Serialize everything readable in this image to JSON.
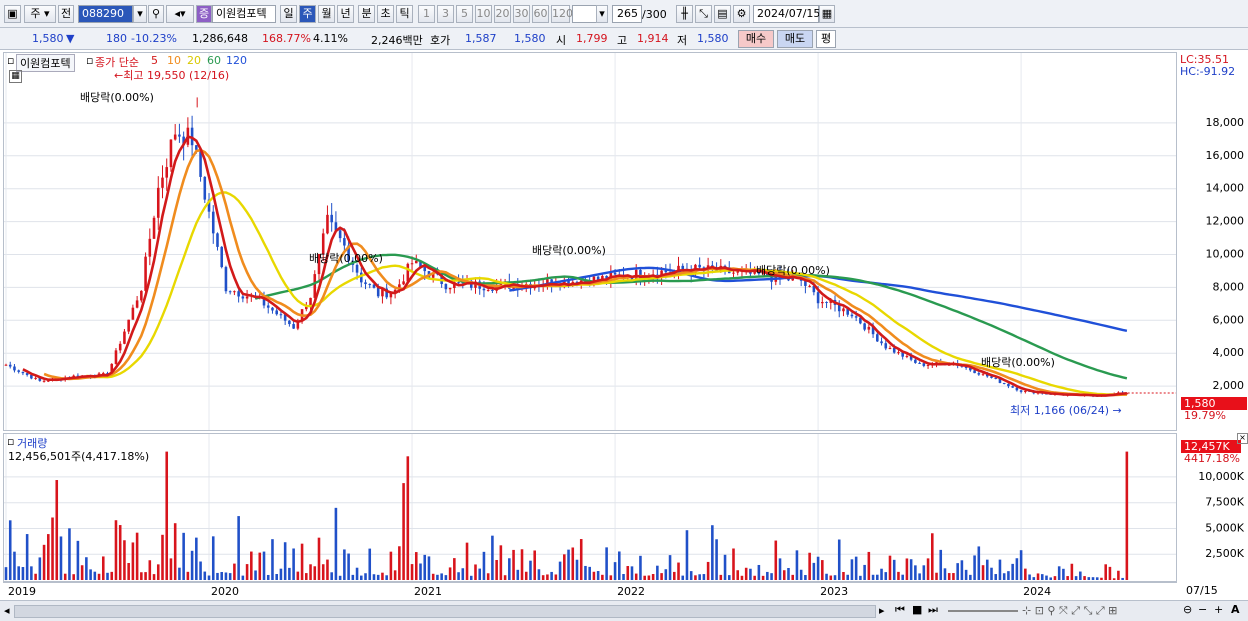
{
  "toolbar": {
    "period_label": "주",
    "prev_label": "전",
    "code": "088290",
    "stock_name_tag": "증",
    "stock_name": "이원컴포텍",
    "tabs": [
      "일",
      "주",
      "월",
      "년",
      "분",
      "초",
      "틱"
    ],
    "active_tab": "주",
    "numbers": [
      "1",
      "3",
      "5",
      "10",
      "20",
      "30",
      "60",
      "120"
    ],
    "count": "265",
    "count_total": "/300",
    "date": "2024/07/15"
  },
  "quote": {
    "price": "1,580",
    "change_arrow": "▼",
    "change": "180",
    "change_pct": "-10.23%",
    "volume": "1,286,648",
    "vol_ratio": "168.77%",
    "turnover": "4.11%",
    "amount": "2,246백만",
    "hoga_label": "호가",
    "hoga_ask": "1,587",
    "hoga_bid": "1,580",
    "open_label": "시",
    "open": "1,799",
    "high_label": "고",
    "high": "1,914",
    "low_label": "저",
    "low": "1,580",
    "buy_label": "매수",
    "sell_label": "매도",
    "eval_label": "평"
  },
  "price_pane": {
    "name": "이원컴포텍",
    "ma_legend": "종가 단순",
    "ma_periods": [
      "5",
      "10",
      "20",
      "60",
      "120"
    ],
    "ma_colors": [
      "#d21a1a",
      "#f08c1e",
      "#e8d800",
      "#2a9a50",
      "#2050d8"
    ],
    "high_note": "←최고 19,550 (12/16)",
    "low_note": "최저 1,166 (06/24) →",
    "lc_label": "LC:35.51",
    "hc_label": "HC:-91.92",
    "dividend_label": "배당락(0.00%)",
    "last_price_tag": "1,580",
    "last_pct_tag": "19.79%"
  },
  "volume_pane": {
    "title": "거래량",
    "last_value": "12,456,501주(4,417.18%)",
    "last_tag": "12,457K",
    "last_pct": "4417.18%"
  },
  "chart_data": [
    {
      "type": "line",
      "title": "이원컴포텍 주봉",
      "x": [
        "2019-01",
        "2019-03",
        "2019-05",
        "2019-07",
        "2019-09",
        "2019-10",
        "2019-11",
        "2019-12",
        "2020-01",
        "2020-02",
        "2020-03",
        "2020-04",
        "2020-06",
        "2020-07",
        "2020-08",
        "2020-09",
        "2020-10",
        "2020-11",
        "2020-12",
        "2021-01",
        "2021-03",
        "2021-06",
        "2021-09",
        "2021-12",
        "2022-03",
        "2022-06",
        "2022-09",
        "2022-12",
        "2023-01",
        "2023-03",
        "2023-05",
        "2023-07",
        "2023-09",
        "2023-11",
        "2024-01",
        "2024-03",
        "2024-05",
        "2024-07"
      ],
      "series": [
        {
          "name": "종가",
          "values": [
            3300,
            2300,
            2600,
            2700,
            8000,
            14000,
            17500,
            17000,
            12500,
            8000,
            7600,
            7200,
            5600,
            7500,
            12000,
            10500,
            8500,
            7600,
            7800,
            9500,
            8200,
            8100,
            8300,
            8500,
            8900,
            9100,
            8800,
            8400,
            7300,
            6400,
            4400,
            3300,
            3400,
            2600,
            1700,
            1500,
            1400,
            1580
          ]
        }
      ],
      "ylim": [
        0,
        20000
      ],
      "yticks": [
        2000,
        4000,
        6000,
        8000,
        10000,
        12000,
        14000,
        16000,
        18000
      ],
      "high": 19550,
      "low": 1166,
      "last": 1580
    },
    {
      "type": "bar",
      "title": "거래량",
      "ylim": [
        0,
        13000
      ],
      "yticks": [
        "2,500K",
        "5,000K",
        "7,500K",
        "10,000K"
      ],
      "last": 12456501
    }
  ],
  "xaxis": {
    "labels": [
      "2019",
      "2020",
      "2021",
      "2022",
      "2023",
      "2024"
    ],
    "last_label": "07/15"
  },
  "chart_icons": [
    "chart-icon",
    "settings-icon",
    "zoom-in-icon",
    "zoom-out-icon",
    "fullscreen-icon"
  ]
}
